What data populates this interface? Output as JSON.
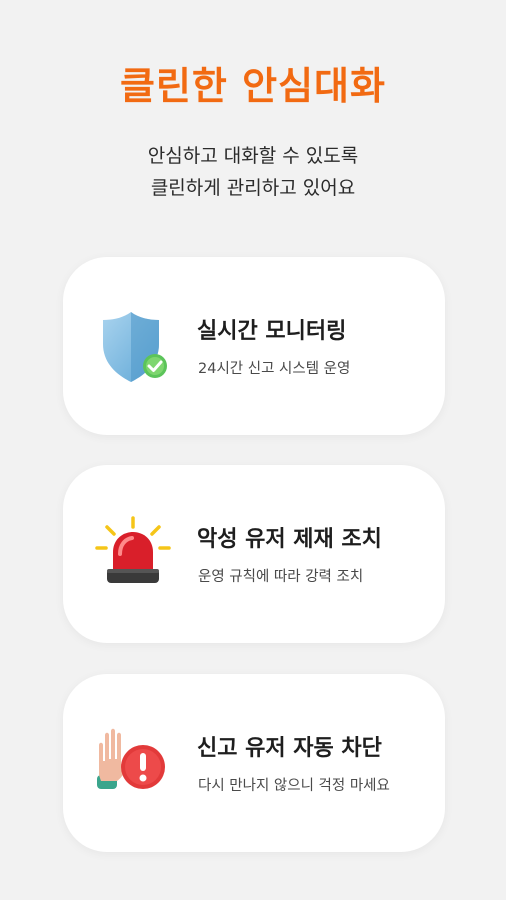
{
  "header": {
    "title": "클린한 안심대화",
    "subtitle_line1": "안심하고 대화할 수 있도록",
    "subtitle_line2": "클린하게 관리하고 있어요"
  },
  "features": [
    {
      "icon": "shield-check-icon",
      "title": "실시간 모니터링",
      "description": "24시간 신고 시스템 운영"
    },
    {
      "icon": "siren-icon",
      "title": "악성 유저 제재 조치",
      "description": "운영 규칙에 따라 강력 조치"
    },
    {
      "icon": "hand-stop-alert-icon",
      "title": "신고 유저 자동 차단",
      "description": "다시 만나지 않으니 걱정 마세요"
    }
  ],
  "colors": {
    "accent": "#f26a12",
    "background": "#f2f2f2",
    "card": "#ffffff"
  }
}
